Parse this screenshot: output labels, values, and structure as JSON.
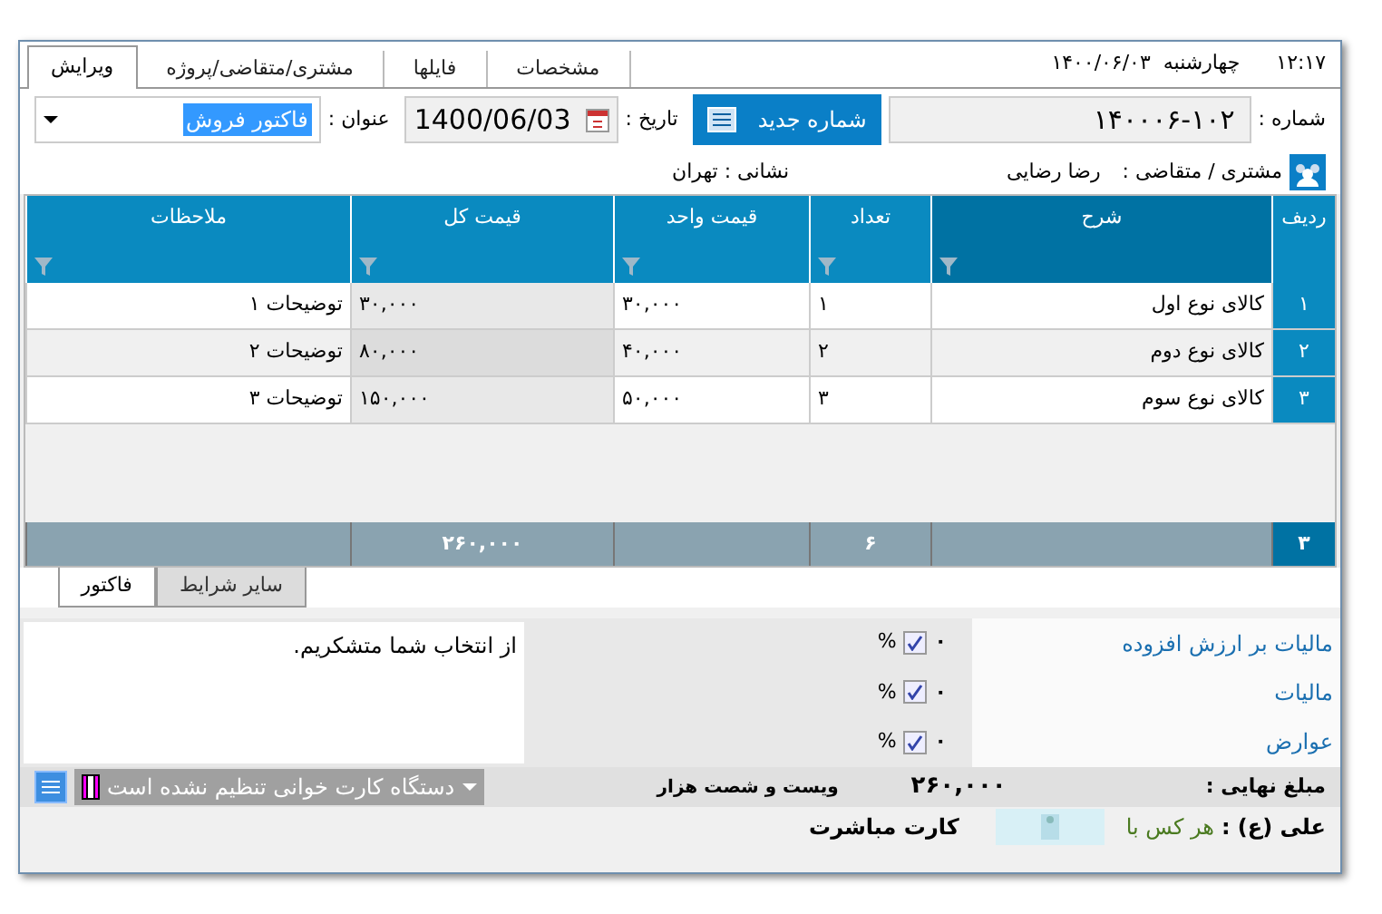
{
  "header": {
    "time": "۱۲:۱۷",
    "date": "چهارشنبه  ۱۴۰۰/۰۶/۰۳"
  },
  "tabs": [
    {
      "label": "مشخصات",
      "selected": false
    },
    {
      "label": "فایلها",
      "selected": false
    },
    {
      "label": "مشتری/متقاضی/پروژه",
      "selected": false
    },
    {
      "label": "ویرایش",
      "selected": true
    }
  ],
  "form": {
    "number_label": "شماره :",
    "number": "۱۴۰۰۰۶-۱۰۲",
    "new_number_button": "شماره جدید",
    "date_label": "تاریخ :",
    "date": "1400/06/03",
    "title_label": "عنوان :",
    "title_value": "فاکتور فروش",
    "customer_label": "مشتری / متقاضی :",
    "customer": "رضا رضایی",
    "address": "نشانی : تهران"
  },
  "table": {
    "columns": [
      {
        "label": "ردیف",
        "filter": false,
        "selected": false
      },
      {
        "label": "شرح",
        "filter": true,
        "selected": true
      },
      {
        "label": "تعداد",
        "filter": true,
        "selected": false
      },
      {
        "label": "قیمت واحد",
        "filter": true,
        "selected": false
      },
      {
        "label": "قیمت کل",
        "filter": true,
        "selected": false
      },
      {
        "label": "ملاحظات",
        "filter": true,
        "selected": false
      }
    ],
    "rows": [
      {
        "cells": [
          "۱",
          "کالای نوع اول",
          "۱",
          "۳۰,۰۰۰",
          "۳۰,۰۰۰",
          "توضیحات ۱"
        ]
      },
      {
        "cells": [
          "۲",
          "کالای نوع دوم",
          "۲",
          "۴۰,۰۰۰",
          "۸۰,۰۰۰",
          "توضیحات ۲"
        ]
      },
      {
        "cells": [
          "۳",
          "کالای نوع سوم",
          "۳",
          "۵۰,۰۰۰",
          "۱۵۰,۰۰۰",
          "توضیحات ۳"
        ]
      }
    ],
    "footer": {
      "row_count": "۳",
      "quantity": "۶",
      "total": "۲۶۰,۰۰۰"
    }
  },
  "bottom_tabs": [
    {
      "label": "سایر شرایط",
      "selected": false
    },
    {
      "label": "فاکتور",
      "selected": true
    }
  ],
  "note": "از انتخاب شما متشکریم.",
  "taxes": [
    {
      "label": "مالیات بر ارزش افزوده",
      "value": "۰",
      "checked": true,
      "unit": "%"
    },
    {
      "label": "مالیات",
      "value": "۰",
      "checked": true,
      "unit": "%"
    },
    {
      "label": "عوارض",
      "value": "۰",
      "checked": true,
      "unit": "%"
    }
  ],
  "amount_words": "ویست و شصت هزار",
  "card_reader": "دستگاه کارت خوانی تنظیم نشده است",
  "final_label": "مبلغ نهایی :",
  "final_amount": "۲۶۰,۰۰۰",
  "signature_label": "علی (ع) :",
  "quote": "هر کس با",
  "card_title": "کارت مباشرت"
}
